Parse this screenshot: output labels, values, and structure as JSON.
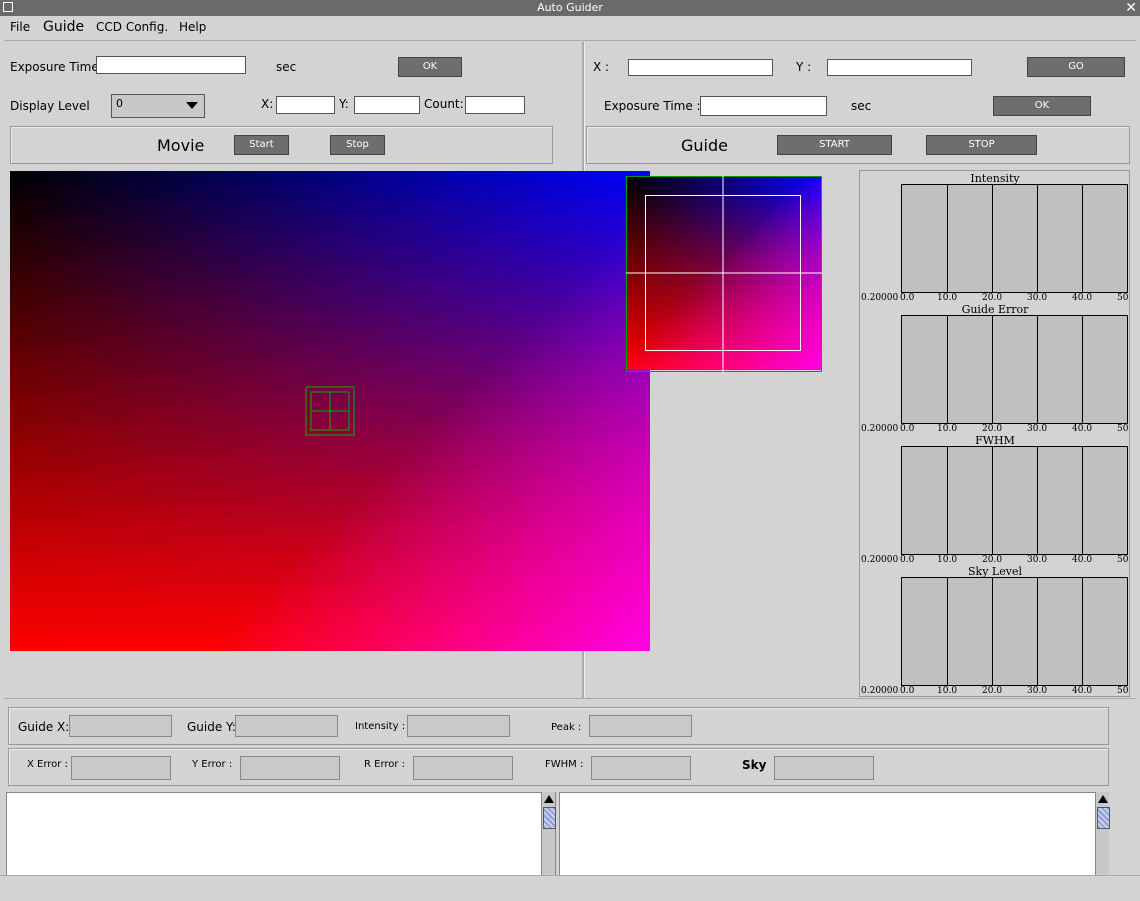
{
  "window": {
    "title": "Auto Guider",
    "close_glyph": "✕"
  },
  "menu": [
    "File",
    "Guide",
    "CCD Config.",
    "Help"
  ],
  "left": {
    "exposure_label": "Exposure Time",
    "exposure_value": "",
    "exposure_unit": "sec",
    "ok_label": "OK",
    "display_level_label": "Display Level",
    "display_level_value": "0",
    "x_label": "X:",
    "y_label": "Y:",
    "count_label": "Count:",
    "movie_label": "Movie",
    "start_label": "Start",
    "stop_label": "Stop"
  },
  "right": {
    "x_label": "X :",
    "y_label": "Y :",
    "go_label": "GO",
    "exposure_label": "Exposure Time :",
    "exposure_unit": "sec",
    "ok_label": "OK",
    "guide_label": "Guide",
    "start_label": "START",
    "stop_label": "STOP"
  },
  "charts": [
    {
      "title": "Intensity",
      "y_label": "0.20000",
      "x_ticks": [
        "0.0",
        "10.0",
        "20.0",
        "30.0",
        "40.0",
        "50"
      ]
    },
    {
      "title": "Guide Error",
      "y_label": "0.20000",
      "x_ticks": [
        "0.0",
        "10.0",
        "20.0",
        "30.0",
        "40.0",
        "50"
      ]
    },
    {
      "title": "FWHM",
      "y_label": "0.20000",
      "x_ticks": [
        "0.0",
        "10.0",
        "20.0",
        "30.0",
        "40.0",
        "50"
      ]
    },
    {
      "title": "Sky Level",
      "y_label": "0.20000",
      "x_ticks": [
        "0.0",
        "10.0",
        "20.0",
        "30.0",
        "40.0",
        "50"
      ]
    }
  ],
  "status": {
    "guide_x_label": "Guide X:",
    "guide_y_label": "Guide Y:",
    "intensity_label": "Intensity :",
    "peak_label": "Peak :",
    "x_error_label": "X Error :",
    "y_error_label": "Y Error :",
    "r_error_label": "R Error :",
    "fwhm_label": "FWHM :",
    "sky_label": "Sky"
  },
  "colors": {
    "button": "#6e6e6e",
    "background": "#d3d3d3"
  }
}
